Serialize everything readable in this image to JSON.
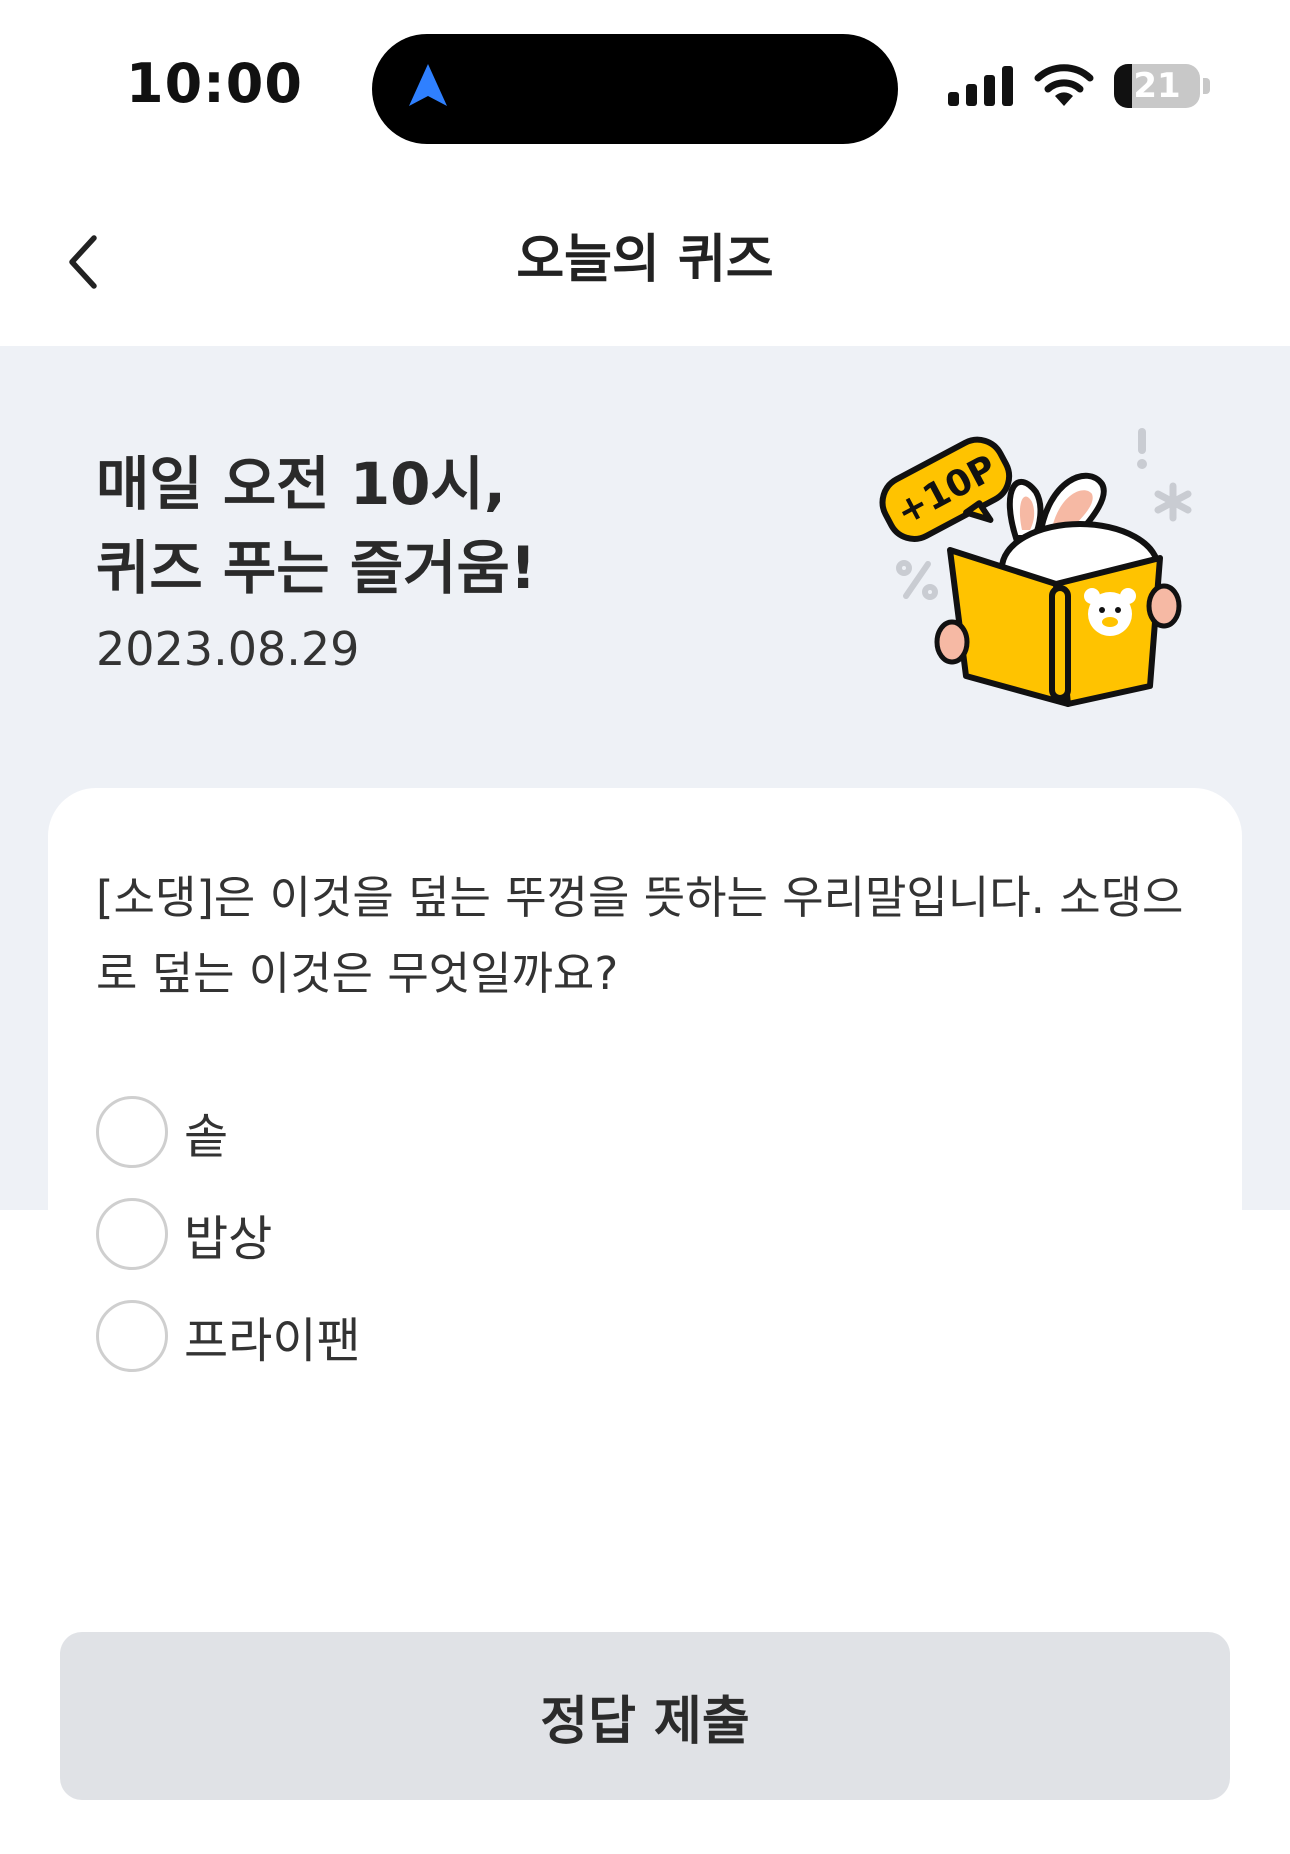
{
  "status_bar": {
    "time": "10:00",
    "battery_level": "21",
    "icons": [
      "navigation-arrow-icon",
      "cellular-signal-icon",
      "wifi-icon",
      "battery-icon"
    ]
  },
  "header": {
    "title": "오늘의 퀴즈",
    "back_icon": "chevron-left-icon"
  },
  "banner": {
    "title_line1": "매일 오전 10시,",
    "title_line2": "퀴즈 푸는 즐거움!",
    "date": "2023.08.29",
    "badge_text": "+10P"
  },
  "quiz": {
    "question_line1": "[소댕]은 이것을 덮는 뚜껑을 뜻하는 우리말입니다. 소댕으",
    "question_line2": "로 덮는 이것은 무엇일까요?",
    "options": [
      {
        "label": "솥",
        "selected": false
      },
      {
        "label": "밥상",
        "selected": false
      },
      {
        "label": "프라이팬",
        "selected": false
      }
    ]
  },
  "submit": {
    "label": "정답 제출"
  },
  "colors": {
    "banner_bg": "#eef1f6",
    "book_yellow": "#ffc300",
    "nav_arrow_blue": "#2f80ff",
    "submit_bg": "#e0e2e6"
  }
}
